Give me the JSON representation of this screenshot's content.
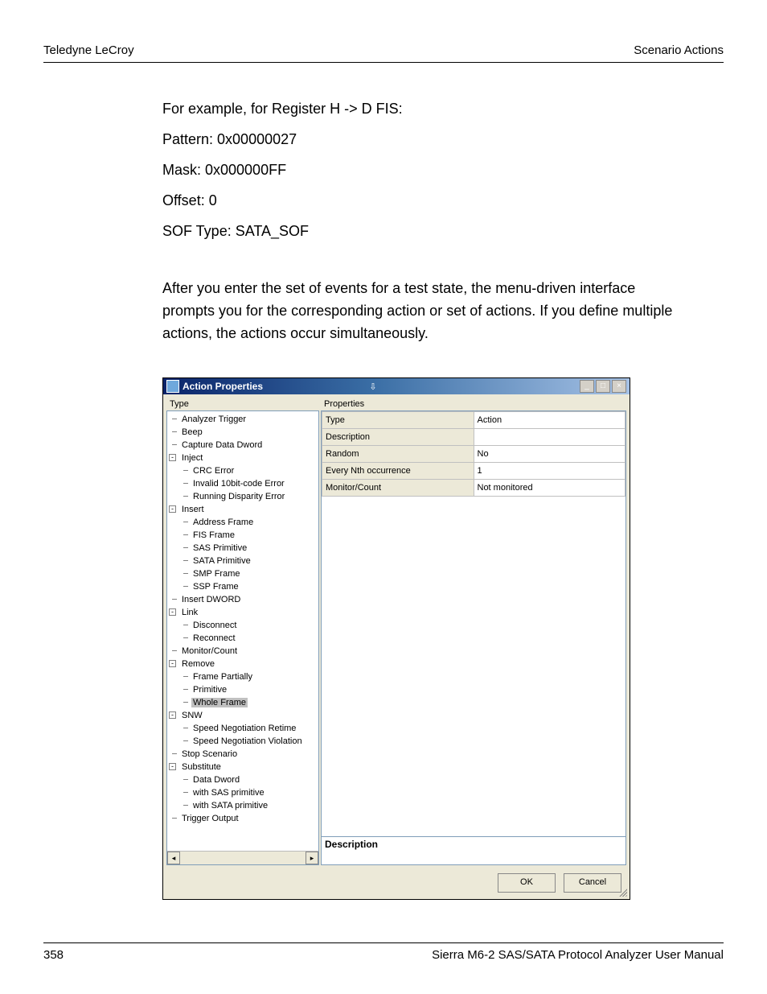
{
  "header": {
    "left": "Teledyne LeCroy",
    "right": "Scenario Actions"
  },
  "body": {
    "lines": [
      "For example, for Register H -> D FIS:",
      "Pattern: 0x00000027",
      "Mask: 0x000000FF",
      "Offset: 0",
      "SOF Type: SATA_SOF"
    ],
    "para2": "After you enter the set of events for a test state, the menu-driven interface prompts you for the corresponding action or set of actions. If you define multiple actions, the actions occur simultaneously."
  },
  "dialog": {
    "title": "Action Properties",
    "leftLabel": "Type",
    "rightLabel": "Properties",
    "descLabel": "Description",
    "ok": "OK",
    "cancel": "Cancel",
    "winbtns": {
      "min": "_",
      "max": "□",
      "close": "×"
    },
    "tree": [
      {
        "label": "Analyzer Trigger"
      },
      {
        "label": "Beep"
      },
      {
        "label": "Capture Data Dword"
      },
      {
        "label": "Inject",
        "expanded": true,
        "children": [
          {
            "label": "CRC Error"
          },
          {
            "label": "Invalid 10bit-code Error"
          },
          {
            "label": "Running Disparity Error"
          }
        ]
      },
      {
        "label": "Insert",
        "expanded": true,
        "children": [
          {
            "label": "Address Frame"
          },
          {
            "label": "FIS Frame"
          },
          {
            "label": "SAS Primitive"
          },
          {
            "label": "SATA Primitive"
          },
          {
            "label": "SMP Frame"
          },
          {
            "label": "SSP Frame"
          }
        ]
      },
      {
        "label": "Insert DWORD"
      },
      {
        "label": "Link",
        "expanded": true,
        "children": [
          {
            "label": "Disconnect"
          },
          {
            "label": "Reconnect"
          }
        ]
      },
      {
        "label": "Monitor/Count"
      },
      {
        "label": "Remove",
        "expanded": true,
        "children": [
          {
            "label": "Frame Partially"
          },
          {
            "label": "Primitive"
          },
          {
            "label": "Whole Frame",
            "selected": true
          }
        ]
      },
      {
        "label": "SNW",
        "expanded": true,
        "children": [
          {
            "label": "Speed Negotiation Retime"
          },
          {
            "label": "Speed Negotiation Violation"
          }
        ]
      },
      {
        "label": "Stop Scenario"
      },
      {
        "label": "Substitute",
        "expanded": true,
        "children": [
          {
            "label": "Data Dword"
          },
          {
            "label": "with SAS primitive"
          },
          {
            "label": "with SATA primitive"
          }
        ]
      },
      {
        "label": "Trigger Output"
      }
    ],
    "props": [
      {
        "k": "Type",
        "v": "Action"
      },
      {
        "k": "Description",
        "v": ""
      },
      {
        "k": "Random",
        "v": "No"
      },
      {
        "k": "Every Nth occurrence",
        "v": "1"
      },
      {
        "k": "Monitor/Count",
        "v": "Not monitored"
      }
    ]
  },
  "footer": {
    "page": "358",
    "title": "Sierra M6-2 SAS/SATA Protocol Analyzer User Manual"
  }
}
